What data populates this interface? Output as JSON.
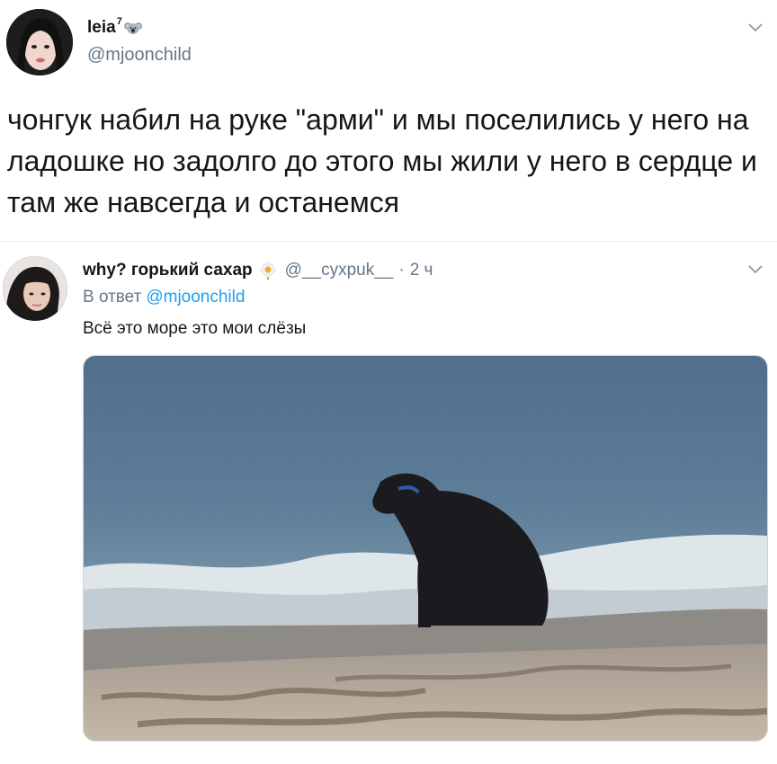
{
  "tweet": {
    "display_name": "leia",
    "name_superscript": "7",
    "handle": "@mjoonchild",
    "text": "чонгук набил на руке \"арми\" и мы поселились у него на ладошке но задолго до этого мы жили у него в сердце и там же навсегда и останемся",
    "name_emoji_icon": "koala-icon",
    "menu_icon": "chevron-down-icon"
  },
  "reply": {
    "display_name": "why? горький сахар",
    "name_emoji_icon": "flower-icon",
    "handle": "@__cyxpuk__",
    "separator": "·",
    "time": "2 ч",
    "reply_to_prefix": "В ответ",
    "reply_to_handle": "@mjoonchild",
    "text": "Всё это море это мои слёзы",
    "menu_icon": "chevron-down-icon",
    "media_description_icon": "photo"
  },
  "colors": {
    "text_primary": "#14171a",
    "text_secondary": "#657786",
    "link": "#1da1f2",
    "divider": "#e6ecf0"
  }
}
